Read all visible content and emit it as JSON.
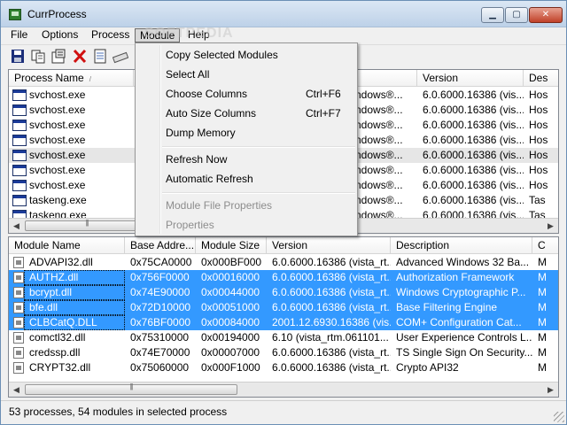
{
  "window": {
    "title": "CurrProcess"
  },
  "menubar": [
    "File",
    "Options",
    "Process",
    "Module",
    "Help"
  ],
  "watermark": "SOFTPEDIA",
  "toolbar": {
    "icons": [
      "save-icon",
      "copy-icon",
      "properties-icon",
      "delete-icon",
      "report-icon",
      "refresh-icon"
    ]
  },
  "process_list": {
    "columns": [
      "Process Name",
      "Version",
      "Des"
    ],
    "rows": [
      {
        "name": "svchost.exe",
        "company": "ndows®...",
        "version": "6.0.6000.16386 (vis...",
        "desc": "Hos"
      },
      {
        "name": "svchost.exe",
        "company": "ndows®...",
        "version": "6.0.6000.16386 (vis...",
        "desc": "Hos"
      },
      {
        "name": "svchost.exe",
        "company": "ndows®...",
        "version": "6.0.6000.16386 (vis...",
        "desc": "Hos"
      },
      {
        "name": "svchost.exe",
        "company": "ndows®...",
        "version": "6.0.6000.16386 (vis...",
        "desc": "Hos"
      },
      {
        "name": "svchost.exe",
        "company": "ndows®...",
        "version": "6.0.6000.16386 (vis...",
        "desc": "Hos"
      },
      {
        "name": "svchost.exe",
        "company": "ndows®...",
        "version": "6.0.6000.16386 (vis...",
        "desc": "Hos"
      },
      {
        "name": "svchost.exe",
        "company": "ndows®...",
        "version": "6.0.6000.16386 (vis...",
        "desc": "Hos"
      },
      {
        "name": "taskeng.exe",
        "company": "ndows®...",
        "version": "6.0.6000.16386 (vis...",
        "desc": "Tas"
      },
      {
        "name": "taskeng.exe",
        "company": "ndows®...",
        "version": "6.0.6000.16386 (vis...",
        "desc": "Tas"
      }
    ]
  },
  "module_list": {
    "columns": [
      "Module Name",
      "Base Addre...",
      "Module Size",
      "Version",
      "Description",
      "C"
    ],
    "rows": [
      {
        "name": "ADVAPI32.dll",
        "base": "0x75CA0000",
        "size": "0x000BF000",
        "version": "6.0.6000.16386 (vista_rt...",
        "desc": "Advanced Windows 32 Ba...",
        "c": "M"
      },
      {
        "name": "AUTHZ.dll",
        "base": "0x756F0000",
        "size": "0x00016000",
        "version": "6.0.6000.16386 (vista_rt...",
        "desc": "Authorization Framework",
        "c": "M"
      },
      {
        "name": "bcrypt.dll",
        "base": "0x74E90000",
        "size": "0x00044000",
        "version": "6.0.6000.16386 (vista_rt...",
        "desc": "Windows Cryptographic P...",
        "c": "M"
      },
      {
        "name": "bfe.dll",
        "base": "0x72D10000",
        "size": "0x00051000",
        "version": "6.0.6000.16386 (vista_rt...",
        "desc": "Base Filtering Engine",
        "c": "M"
      },
      {
        "name": "CLBCatQ.DLL",
        "base": "0x76BF0000",
        "size": "0x00084000",
        "version": "2001.12.6930.16386 (vis...",
        "desc": "COM+ Configuration Cat...",
        "c": "M"
      },
      {
        "name": "comctl32.dll",
        "base": "0x75310000",
        "size": "0x00194000",
        "version": "6.10 (vista_rtm.061101...",
        "desc": "User Experience Controls L...",
        "c": "M"
      },
      {
        "name": "credssp.dll",
        "base": "0x74E70000",
        "size": "0x00007000",
        "version": "6.0.6000.16386 (vista_rt...",
        "desc": "TS Single Sign On Security...",
        "c": "M"
      },
      {
        "name": "CRYPT32.dll",
        "base": "0x75060000",
        "size": "0x000F1000",
        "version": "6.0.6000.16386 (vista_rt...",
        "desc": "Crypto API32",
        "c": "M"
      }
    ]
  },
  "module_menu": {
    "items": [
      {
        "label": "Copy Selected Modules",
        "key": "",
        "enabled": true
      },
      {
        "label": "Select All",
        "key": "",
        "enabled": true
      },
      {
        "label": "Choose Columns",
        "key": "Ctrl+F6",
        "enabled": true
      },
      {
        "label": "Auto Size Columns",
        "key": "Ctrl+F7",
        "enabled": true
      },
      {
        "label": "Dump Memory",
        "key": "",
        "enabled": true
      },
      {
        "label": "Refresh Now",
        "key": "",
        "enabled": true
      },
      {
        "label": "Automatic Refresh",
        "key": "",
        "enabled": true
      },
      {
        "label": "Module File Properties",
        "key": "",
        "enabled": false
      },
      {
        "label": "Properties",
        "key": "",
        "enabled": false
      }
    ]
  },
  "status": {
    "text": "53 processes, 54 modules in selected process"
  },
  "colors": {
    "selection": "#3399ff",
    "title_gradient_top": "#dbe7f4"
  }
}
